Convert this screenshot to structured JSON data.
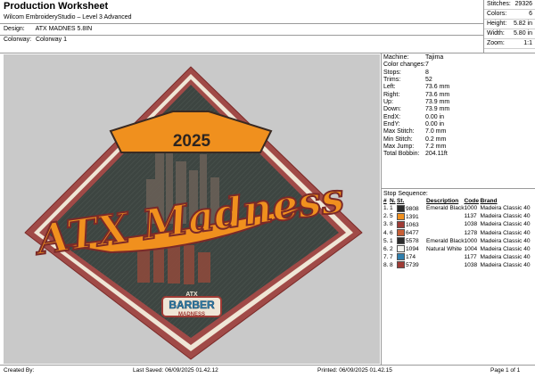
{
  "header": {
    "title": "Production Worksheet",
    "subtitle": "Wilcom EmbroideryStudio – Level 3 Advanced",
    "design_label": "Design:",
    "design_value": "ATX MADNES 5.8IN",
    "colorway_label": "Colorway:",
    "colorway_value": "Colorway 1"
  },
  "summary": [
    {
      "label": "Stitches:",
      "value": "29326"
    },
    {
      "label": "Colors:",
      "value": "6"
    },
    {
      "label": "Height:",
      "value": "5.82 in"
    },
    {
      "label": "Width:",
      "value": "5.80 in"
    },
    {
      "label": "Zoom:",
      "value": "1:1"
    }
  ],
  "machine_info": [
    {
      "label": "Machine:",
      "value": "Tajima"
    },
    {
      "label": "Color changes:",
      "value": "7"
    },
    {
      "label": "Stops:",
      "value": "8"
    },
    {
      "label": "Trims:",
      "value": "52"
    },
    {
      "label": "Left:",
      "value": "73.6 mm"
    },
    {
      "label": "Right:",
      "value": "73.6 mm"
    },
    {
      "label": "Up:",
      "value": "73.9 mm"
    },
    {
      "label": "Down:",
      "value": "73.9 mm"
    },
    {
      "label": "EndX:",
      "value": "0.00 in"
    },
    {
      "label": "EndY:",
      "value": "0.00 in"
    },
    {
      "label": "Max Stitch:",
      "value": "7.0 mm"
    },
    {
      "label": "Min Stitch:",
      "value": "0.2 mm"
    },
    {
      "label": "Max Jump:",
      "value": "7.2 mm"
    },
    {
      "label": "Total Bobbin:",
      "value": "204.11ft"
    }
  ],
  "stop_sequence": {
    "title": "Stop Sequence:",
    "headers": [
      "#",
      "N.",
      "St.",
      "Description",
      "Code",
      "Brand"
    ],
    "rows": [
      {
        "num": "1.",
        "n": "1",
        "color": "#2b2b2b",
        "st": "9808",
        "desc": "Emerald Black",
        "code": "1000",
        "brand": "Madeira Classic 40"
      },
      {
        "num": "2.",
        "n": "5",
        "color": "#f0901e",
        "st": "1391",
        "desc": "",
        "code": "1137",
        "brand": "Madeira Classic 40"
      },
      {
        "num": "3.",
        "n": "8",
        "color": "#9e3b35",
        "st": "1063",
        "desc": "",
        "code": "1038",
        "brand": "Madeira Classic 40"
      },
      {
        "num": "4.",
        "n": "6",
        "color": "#c85f36",
        "st": "6477",
        "desc": "",
        "code": "1278",
        "brand": "Madeira Classic 40"
      },
      {
        "num": "5.",
        "n": "1",
        "color": "#2b2b2b",
        "st": "5578",
        "desc": "Emerald Black",
        "code": "1000",
        "brand": "Madeira Classic 40"
      },
      {
        "num": "6.",
        "n": "2",
        "color": "#f4f4f0",
        "st": "1094",
        "desc": "Natural White",
        "code": "1004",
        "brand": "Madeira Classic 40"
      },
      {
        "num": "7.",
        "n": "7",
        "color": "#2f7fae",
        "st": "174",
        "desc": "",
        "code": "1177",
        "brand": "Madeira Classic 40"
      },
      {
        "num": "8.",
        "n": "8",
        "color": "#9e3b35",
        "st": "5739",
        "desc": "",
        "code": "1038",
        "brand": "Madeira Classic 40"
      }
    ]
  },
  "artwork": {
    "year": "2025",
    "main_text": "ATX Madness",
    "badge_top": "ATX",
    "badge_mid": "BARBER",
    "badge_bottom": "MADNESS",
    "colors": {
      "canvas": "#c9c9c9",
      "outer_border": "#a04a47",
      "cream_border": "#efe6d6",
      "inner_field": "#3d4541",
      "orange": "#f0901e",
      "dark_orange": "#c85f36",
      "outline": "#7b2a28"
    }
  },
  "footer": {
    "created_by": "Created By:",
    "last_saved": "Last Saved: 06/09/2025 01.42.12",
    "printed": "Printed: 06/09/2025 01.42.15",
    "page": "Page 1 of 1"
  }
}
